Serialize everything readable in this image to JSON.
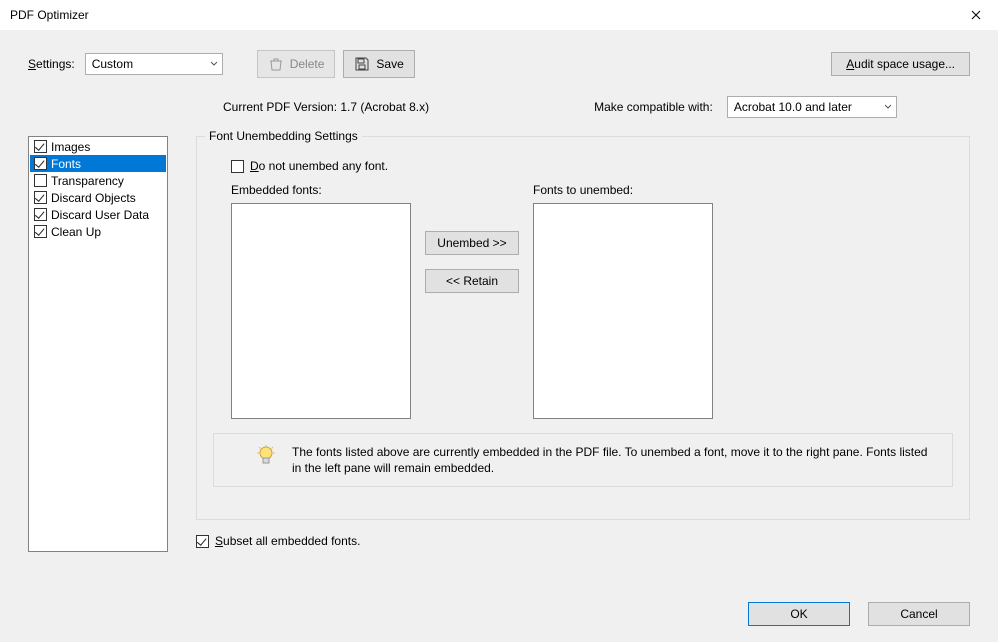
{
  "window": {
    "title": "PDF Optimizer"
  },
  "toolbar": {
    "settings_label": "Settings:",
    "settings_value": "Custom",
    "delete_label": "Delete",
    "save_label": "Save",
    "audit_label": "Audit space usage..."
  },
  "version_row": {
    "current_label": "Current PDF Version: 1.7 (Acrobat 8.x)",
    "compat_label": "Make compatible with:",
    "compat_value": "Acrobat 10.0 and later"
  },
  "categories": [
    {
      "label": "Images",
      "checked": true,
      "selected": false
    },
    {
      "label": "Fonts",
      "checked": true,
      "selected": true
    },
    {
      "label": "Transparency",
      "checked": false,
      "selected": false
    },
    {
      "label": "Discard Objects",
      "checked": true,
      "selected": false
    },
    {
      "label": "Discard User Data",
      "checked": true,
      "selected": false
    },
    {
      "label": "Clean Up",
      "checked": true,
      "selected": false
    }
  ],
  "fonts_panel": {
    "group_title": "Font Unembedding Settings",
    "do_not_unembed_label": "Do not unembed any font.",
    "do_not_unembed_checked": false,
    "embedded_label": "Embedded fonts:",
    "to_unembed_label": "Fonts to unembed:",
    "unembed_btn": "Unembed >>",
    "retain_btn": "<< Retain",
    "hint": "The fonts listed above are currently embedded in the PDF file. To unembed a font, move it to the right pane. Fonts listed in the left pane will remain embedded.",
    "subset_label": "Subset all embedded fonts.",
    "subset_checked": true
  },
  "footer": {
    "ok": "OK",
    "cancel": "Cancel"
  }
}
